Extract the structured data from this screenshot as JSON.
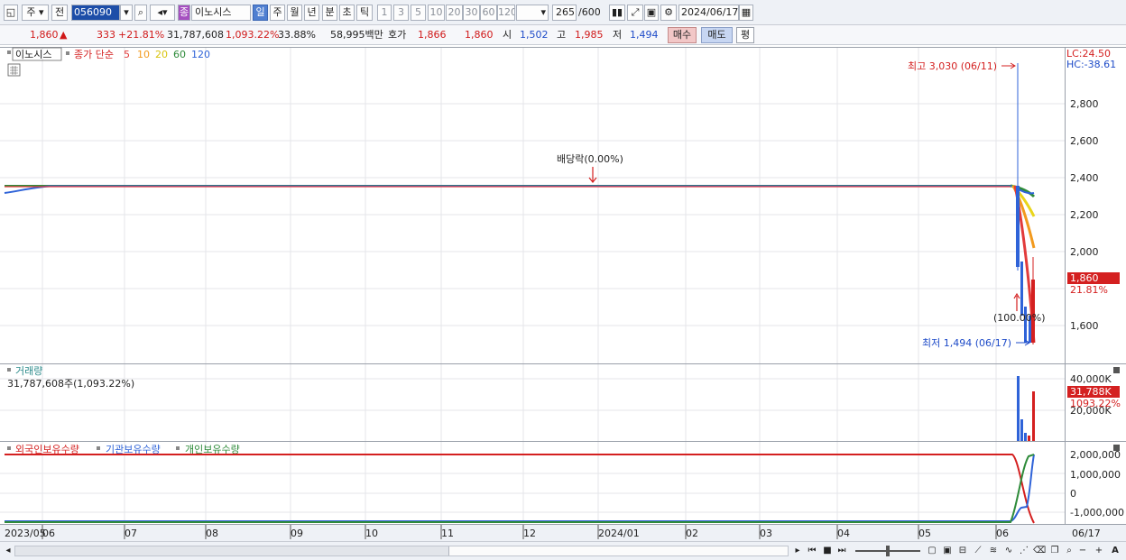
{
  "toolbar": {
    "period_select": "주",
    "jeon_label": "전",
    "stock_code": "056090",
    "stock_badge": "종",
    "stock_name": "이노시스",
    "period_tabs": [
      "일",
      "주",
      "월",
      "년",
      "분",
      "초",
      "틱"
    ],
    "active_period": "일",
    "interval_buttons": [
      "1",
      "3",
      "5",
      "10",
      "20",
      "30",
      "60",
      "120"
    ],
    "count_current": "265",
    "count_total": "/600",
    "date_value": "2024/06/17"
  },
  "quote": {
    "price": "1,860",
    "up_arrow": "▲",
    "change": "333",
    "change_pct": "+21.81%",
    "volume": "31,787,608",
    "volume_pct": "1,093.22%",
    "turnover": "33.88%",
    "trade_value": "58,995백만",
    "hoga_label": "호가",
    "ask": "1,866",
    "bid": "1,860",
    "open_label": "시",
    "open": "1,502",
    "high_label": "고",
    "high": "1,985",
    "low_label": "저",
    "low": "1,494",
    "buy_button": "매수",
    "sell_button": "매도",
    "avg_button": "평"
  },
  "price_panel": {
    "stock_label": "이노시스",
    "ma_label": "종가 단순",
    "ma_periods": [
      "5",
      "10",
      "20",
      "60",
      "120"
    ],
    "ma_colors": [
      "#e23b3b",
      "#f29a1e",
      "#e9d51a",
      "#2e8b3a",
      "#2f63d8"
    ],
    "lc_label": "LC:24.50",
    "hc_label": "HC:-38.61",
    "high_marker": "최고 3,030 (06/11)",
    "low_marker": "최저 1,494 (06/17)",
    "dividend_label": "배당락(0.00%)",
    "split_label": "(100.00%)",
    "current_price_tag": "1,860",
    "current_pct_tag": "21.81%",
    "y_ticks": [
      "2,800",
      "2,600",
      "2,400",
      "2,200",
      "2,000",
      "1,600"
    ]
  },
  "volume_panel": {
    "title": "거래량",
    "value_label": "31,787,608주(1,093.22%)",
    "y_ticks": [
      "40,000K",
      "20,000K"
    ],
    "current_tag": "31,788K",
    "pct_tag": "1093.22%"
  },
  "holding_panel": {
    "legend": [
      "외국인보유수량",
      "기관보유수량",
      "개인보유수량"
    ],
    "legend_colors": [
      "#d42020",
      "#2f63d8",
      "#2e8b3a"
    ],
    "y_ticks": [
      "2,000,000",
      "1,000,000",
      "0",
      "-1,000,000"
    ]
  },
  "x_axis": {
    "labels": [
      "2023/05",
      "06",
      "07",
      "08",
      "09",
      "10",
      "11",
      "12",
      "2024/01",
      "02",
      "03",
      "04",
      "05",
      "06"
    ],
    "right_label": "06/17"
  }
}
